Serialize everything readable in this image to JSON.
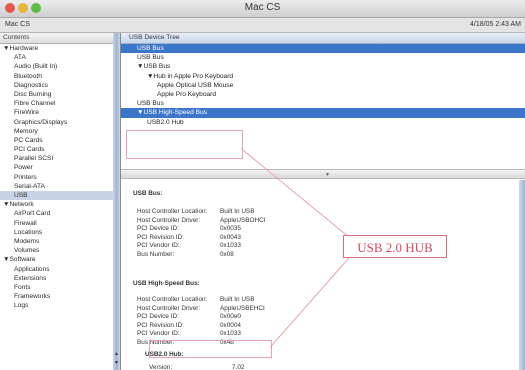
{
  "window": {
    "title": "Mac CS"
  },
  "subbar": {
    "left": "Mac CS",
    "right": "4/18/05 2:43 AM"
  },
  "sidebar": {
    "header": "Contents",
    "rows": [
      {
        "label": "▼Hardware",
        "kind": "cat"
      },
      {
        "label": "ATA",
        "kind": "item"
      },
      {
        "label": "Audio (Built In)",
        "kind": "item"
      },
      {
        "label": "Bluetooth",
        "kind": "item"
      },
      {
        "label": "Diagnostics",
        "kind": "item"
      },
      {
        "label": "Disc Burning",
        "kind": "item"
      },
      {
        "label": "Fibre Channel",
        "kind": "item"
      },
      {
        "label": "FireWire",
        "kind": "item"
      },
      {
        "label": "Graphics/Displays",
        "kind": "item"
      },
      {
        "label": "Memory",
        "kind": "item"
      },
      {
        "label": "PC Cards",
        "kind": "item"
      },
      {
        "label": "PCI Cards",
        "kind": "item"
      },
      {
        "label": "Parallel SCSI",
        "kind": "item"
      },
      {
        "label": "Power",
        "kind": "item"
      },
      {
        "label": "Printers",
        "kind": "item"
      },
      {
        "label": "Serial-ATA",
        "kind": "item"
      },
      {
        "label": "USB",
        "kind": "item",
        "selected": true
      },
      {
        "label": "▼Network",
        "kind": "cat"
      },
      {
        "label": "AirPort Card",
        "kind": "item"
      },
      {
        "label": "Firewall",
        "kind": "item"
      },
      {
        "label": "Locations",
        "kind": "item"
      },
      {
        "label": "Modems",
        "kind": "item"
      },
      {
        "label": "Volumes",
        "kind": "item"
      },
      {
        "label": "▼Software",
        "kind": "cat"
      },
      {
        "label": "Applications",
        "kind": "item"
      },
      {
        "label": "Extensions",
        "kind": "item"
      },
      {
        "label": "Fonts",
        "kind": "item"
      },
      {
        "label": "Frameworks",
        "kind": "item"
      },
      {
        "label": "Logs",
        "kind": "item"
      }
    ]
  },
  "tree": {
    "header": "USB Device Tree",
    "rows": [
      {
        "label": "USB Bus",
        "indent": 1,
        "selected": true
      },
      {
        "label": "USB Bus",
        "indent": 1
      },
      {
        "label": "▼USB Bus",
        "indent": 1
      },
      {
        "label": "▼Hub in Apple Pro Keyboard",
        "indent": 2
      },
      {
        "label": "Apple Optical USB Mouse",
        "indent": 3
      },
      {
        "label": "Apple Pro Keyboard",
        "indent": 3
      },
      {
        "label": "USB Bus",
        "indent": 1
      },
      {
        "label": "▼USB High-Speed Bus",
        "indent": 1,
        "selected": true
      },
      {
        "label": "USB2.0 Hub",
        "indent": 2
      }
    ]
  },
  "detail": {
    "section1_title": "USB Bus:",
    "section1": [
      {
        "k": "Host Controller Location:",
        "v": "Built In USB"
      },
      {
        "k": "Host Controller Driver:",
        "v": "AppleUSBOHCI"
      },
      {
        "k": "PCI Device ID:",
        "v": "0x0035"
      },
      {
        "k": "PCI Revision ID:",
        "v": "0x0043"
      },
      {
        "k": "PCI Vendor ID:",
        "v": "0x1033"
      },
      {
        "k": "Bus Number:",
        "v": "0x08"
      }
    ],
    "section2_title": "USB High-Speed Bus:",
    "section2": [
      {
        "k": "Host Controller Location:",
        "v": "Built In USB"
      },
      {
        "k": "Host Controller Driver:",
        "v": "AppleUSBEHCI"
      },
      {
        "k": "PCI Device ID:",
        "v": "0x00e0"
      },
      {
        "k": "PCI Revision ID:",
        "v": "0x0004"
      },
      {
        "k": "PCI Vendor ID:",
        "v": "0x1033"
      },
      {
        "k": "Bus Number:",
        "v": "0x4b"
      }
    ],
    "section3_title": "USB2.0 Hub:",
    "section3": [
      {
        "k": "Version:",
        "v": "7.02"
      }
    ]
  },
  "annotation": {
    "label": "USB 2.0 HUB"
  }
}
